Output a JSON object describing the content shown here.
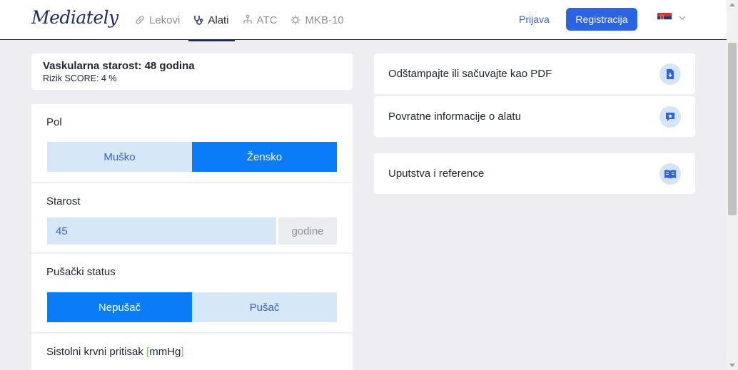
{
  "header": {
    "logo": "Mediately",
    "nav": [
      {
        "label": "Lekovi",
        "icon": "pill-icon",
        "active": false
      },
      {
        "label": "Alati",
        "icon": "stethoscope-icon",
        "active": true
      },
      {
        "label": "ATC",
        "icon": "hierarchy-icon",
        "active": false
      },
      {
        "label": "MKB-10",
        "icon": "virus-icon",
        "active": false
      }
    ],
    "login_label": "Prijava",
    "register_label": "Registracija",
    "language_flag": "serbia-flag-icon"
  },
  "result": {
    "title": "Vaskularna starost: 48 godina",
    "subtitle": "Rizik SCORE: 4 %"
  },
  "form": {
    "sex": {
      "label": "Pol",
      "options": [
        "Muško",
        "Žensko"
      ],
      "selected": "Žensko"
    },
    "age": {
      "label": "Starost",
      "value": "45",
      "unit": "godine"
    },
    "smoking": {
      "label": "Pušački status",
      "options": [
        "Nepušač",
        "Pušač"
      ],
      "selected": "Nepušač"
    },
    "systolic": {
      "label": "Sistolni krvni pritisak",
      "unit_open": "[",
      "unit": "mmHg",
      "unit_close": "]"
    }
  },
  "actions": [
    {
      "label": "Odštampajte ili sačuvajte kao PDF",
      "icon": "pdf-download-icon"
    },
    {
      "label": "Povratne informacije o alatu",
      "icon": "feedback-icon"
    },
    {
      "label": "Uputstva i reference",
      "icon": "book-icon"
    }
  ],
  "colors": {
    "accent": "#0a7cf7",
    "accent_light": "#d6e7f7",
    "brand": "#1e2a5c",
    "register": "#2b63e0"
  }
}
